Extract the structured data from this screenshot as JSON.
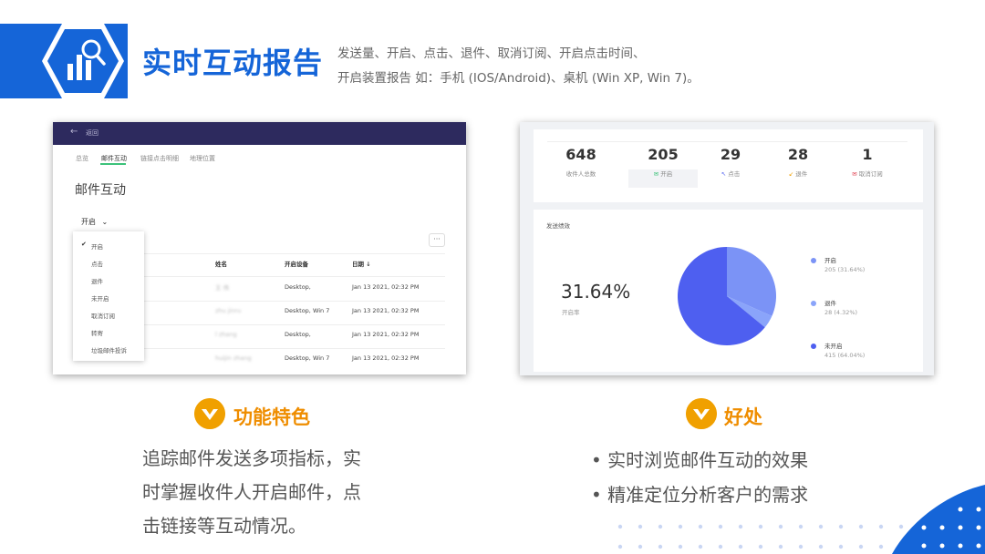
{
  "colors": {
    "brand": "#1565d8",
    "accent": "#ef8d00",
    "pie": [
      "#7b93f6",
      "#8aa4fa",
      "#4e5ff0"
    ]
  },
  "header": {
    "icon": "chart-search-icon",
    "title": "实时互动报告",
    "subtitle_line1": "发送量、开启、点击、退件、取消订阅、开启点击时间、",
    "subtitle_line2": "开启装置报告 如：手机 (IOS/Android)、桌机 (Win XP, Win 7)。"
  },
  "left_screen": {
    "back_label": "返回",
    "tabs": [
      "总览",
      "邮件互动",
      "链接点击明细",
      "地理位置"
    ],
    "heading": "邮件互动",
    "dropdown_value": "开启",
    "menu_items": [
      "开启",
      "点击",
      "退件",
      "未开启",
      "取消订阅",
      "转寄",
      "垃圾邮件投诉"
    ],
    "table": {
      "headers": [
        "姓名",
        "开启设备",
        "日期 ↓"
      ],
      "rows": [
        {
          "name": "王 伟",
          "device": "Desktop,",
          "date": "Jan 13 2021, 02:32 PM"
        },
        {
          "name": "zhu jinru",
          "device": "Desktop, Win 7",
          "date": "Jan 13 2021, 02:32 PM"
        },
        {
          "name": "l zhang",
          "device": "Desktop,",
          "date": "Jan 13 2021, 02:32 PM"
        },
        {
          "name": "huijin zhang",
          "device": "Desktop, Win 7",
          "date": "Jan 13 2021, 02:32 PM"
        }
      ]
    }
  },
  "right_screen": {
    "stats": [
      {
        "value": "648",
        "label": "收件人总数"
      },
      {
        "value": "205",
        "label": "开启"
      },
      {
        "value": "29",
        "label": "点击"
      },
      {
        "value": "28",
        "label": "退件"
      },
      {
        "value": "1",
        "label": "取消订阅"
      }
    ],
    "chart_title": "发送绩效",
    "big_value": "31.64%",
    "big_label": "开启率",
    "chart_data": {
      "type": "pie",
      "categories": [
        "开启",
        "退件",
        "未开启"
      ],
      "values": [
        205,
        28,
        415
      ],
      "percent_labels": [
        "205 (31.64%)",
        "28 (4.32%)",
        "415 (64.04%)"
      ]
    }
  },
  "features": {
    "title": "功能特色",
    "lines": [
      "追踪邮件发送多项指标，实",
      "时掌握收件人开启邮件，点",
      "击链接等互动情况。"
    ]
  },
  "benefits": {
    "title": "好处",
    "items": [
      "实时浏览邮件互动的效果",
      "精准定位分析客户的需求"
    ]
  }
}
